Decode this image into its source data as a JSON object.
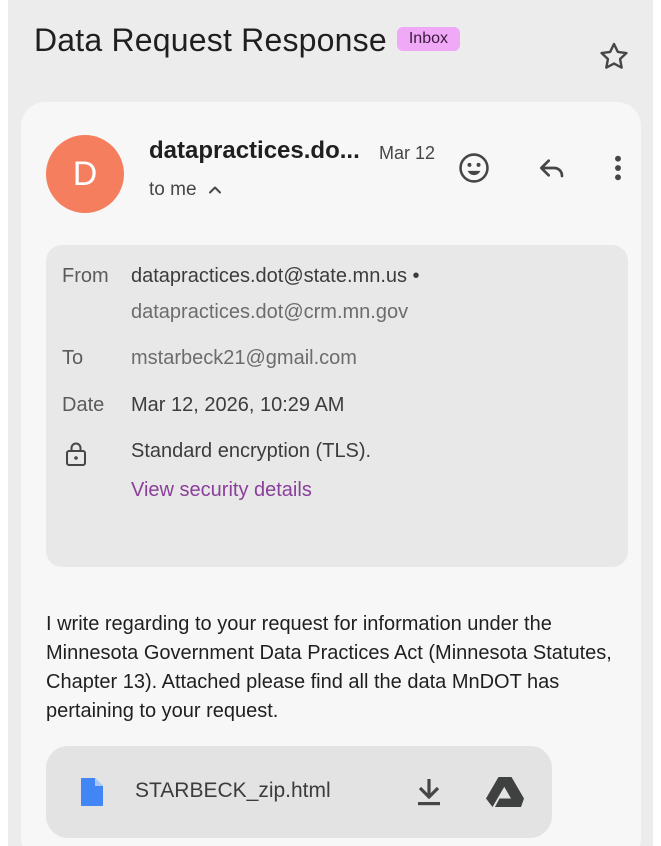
{
  "header": {
    "subject": "Data Request Response",
    "label": "Inbox",
    "star_icon": "star-outline-icon"
  },
  "message": {
    "avatar_letter": "D",
    "sender_display": "datapractices.do...",
    "date_short": "Mar 12",
    "recipient_summary": "to me",
    "actions": {
      "emoji_icon": "emoji-reaction-icon",
      "reply_icon": "reply-icon",
      "more_icon": "more-vert-icon"
    }
  },
  "details": {
    "from_label": "From",
    "from_value": "datapractices.dot@state.mn.us •",
    "from_value_2": "datapractices.dot@crm.mn.gov",
    "to_label": "To",
    "to_value": "mstarbeck21@gmail.com",
    "date_label": "Date",
    "date_value": "Mar 12, 2026, 10:29 AM",
    "security_text": "Standard encryption (TLS).",
    "security_link": "View security details"
  },
  "body": {
    "text": "I write regarding to your request for information under the Minnesota Government Data Practices Act (Minnesota Statutes, Chapter 13). Attached please find all the data MnDOT has pertaining to your request."
  },
  "attachment": {
    "filename": "STARBECK_zip.html",
    "file_icon": "document-icon",
    "download_icon": "download-icon",
    "drive_icon": "google-drive-icon"
  },
  "colors": {
    "avatar": "#f47e5e",
    "label_chip": "#f0a9f7",
    "link": "#8a3f9a",
    "file_icon": "#4285f4"
  }
}
